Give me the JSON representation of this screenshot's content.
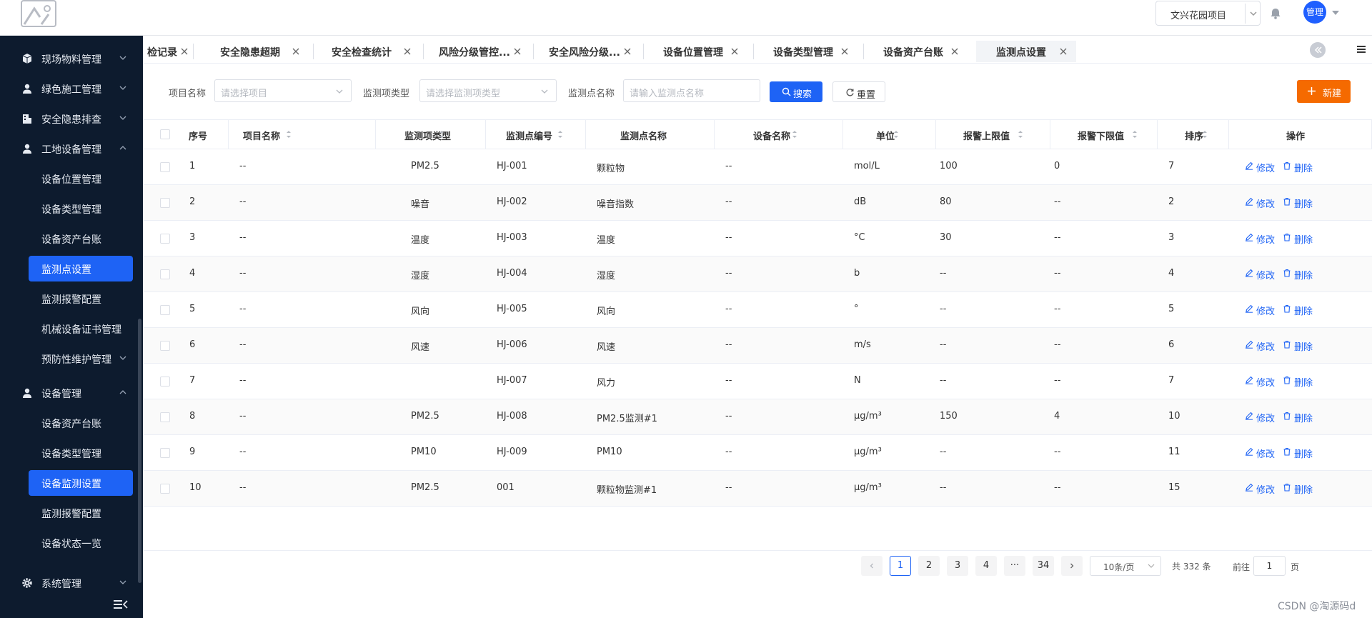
{
  "header": {
    "project_select": "文兴花园项目",
    "avatar_label": "管理"
  },
  "sidebar": {
    "groups": [
      {
        "label": "现场物料管理",
        "icon": "cube-icon",
        "expanded": false
      },
      {
        "label": "绿色施工管理",
        "icon": "user-icon",
        "expanded": false
      },
      {
        "label": "安全隐患排查",
        "icon": "building-icon",
        "expanded": false
      },
      {
        "label": "工地设备管理",
        "icon": "user-icon",
        "expanded": true
      },
      {
        "label": "设备管理",
        "icon": "user-icon",
        "expanded": true
      },
      {
        "label": "系统管理",
        "icon": "gear-icon",
        "expanded": false
      }
    ],
    "site_device_items": [
      {
        "label": "设备位置管理",
        "active": false
      },
      {
        "label": "设备类型管理",
        "active": false
      },
      {
        "label": "设备资产台账",
        "active": false
      },
      {
        "label": "监测点设置",
        "active": true
      },
      {
        "label": "监测报警配置",
        "active": false
      },
      {
        "label": "机械设备证书管理",
        "active": false
      },
      {
        "label": "预防性维护管理",
        "active": false,
        "has_children": true
      }
    ],
    "device_items": [
      {
        "label": "设备资产台账",
        "active": false
      },
      {
        "label": "设备类型管理",
        "active": false
      },
      {
        "label": "设备监测设置",
        "active": true
      },
      {
        "label": "监测报警配置",
        "active": false
      },
      {
        "label": "设备状态一览",
        "active": false
      }
    ]
  },
  "tabs": [
    {
      "label": "检记录"
    },
    {
      "label": "安全隐患超期"
    },
    {
      "label": "安全检查统计"
    },
    {
      "label": "风险分级管控..."
    },
    {
      "label": "安全风险分级..."
    },
    {
      "label": "设备位置管理"
    },
    {
      "label": "设备类型管理"
    },
    {
      "label": "设备资产台账"
    },
    {
      "label": "监测点设置",
      "active": true
    }
  ],
  "filters": {
    "project_label": "项目名称",
    "project_placeholder": "请选择项目",
    "type_label": "监测项类型",
    "type_placeholder": "请选择监测项类型",
    "point_label": "监测点名称",
    "point_placeholder": "请输入监测点名称",
    "search_button": "搜索",
    "reset_button": "重置",
    "new_button": "新建"
  },
  "table": {
    "columns": [
      "序号",
      "项目名称",
      "监测项类型",
      "监测点编号",
      "监测点名称",
      "设备名称",
      "单位",
      "报警上限值",
      "报警下限值",
      "排序",
      "操作"
    ],
    "edit_label": "修改",
    "delete_label": "删除",
    "rows": [
      [
        "1",
        "--",
        "PM2.5",
        "HJ-001",
        "颗粒物",
        "--",
        "mol/L",
        "100",
        "0",
        "7"
      ],
      [
        "2",
        "--",
        "噪音",
        "HJ-002",
        "噪音指数",
        "--",
        "dB",
        "80",
        "--",
        "2"
      ],
      [
        "3",
        "--",
        "温度",
        "HJ-003",
        "温度",
        "--",
        "°C",
        "30",
        "--",
        "3"
      ],
      [
        "4",
        "--",
        "湿度",
        "HJ-004",
        "湿度",
        "--",
        "b",
        "--",
        "--",
        "4"
      ],
      [
        "5",
        "--",
        "风向",
        "HJ-005",
        "风向",
        "--",
        "°",
        "--",
        "--",
        "5"
      ],
      [
        "6",
        "--",
        "风速",
        "HJ-006",
        "风速",
        "--",
        "m/s",
        "--",
        "--",
        "6"
      ],
      [
        "7",
        "--",
        "",
        "HJ-007",
        "风力",
        "--",
        "N",
        "--",
        "--",
        "7"
      ],
      [
        "8",
        "--",
        "PM2.5",
        "HJ-008",
        "PM2.5监测#1",
        "--",
        "μg/m³",
        "150",
        "4",
        "10"
      ],
      [
        "9",
        "--",
        "PM10",
        "HJ-009",
        "PM10",
        "--",
        "μg/m³",
        "--",
        "--",
        "11"
      ],
      [
        "10",
        "--",
        "PM2.5",
        "001",
        "颗粒物监测#1",
        "--",
        "μg/m³",
        "--",
        "--",
        "15"
      ]
    ]
  },
  "pagination": {
    "pages": [
      "1",
      "2",
      "3",
      "4",
      "···",
      "34"
    ],
    "current": "1",
    "page_size": "10条/页",
    "total": "共 332 条",
    "goto_label": "前往",
    "goto_value": "1",
    "page_suffix": "页"
  },
  "watermark": "CSDN @淘源码d",
  "colors": {
    "sidebar_bg": "#0d1b2e",
    "primary": "#1e63f5",
    "new_button": "#f56a00"
  }
}
